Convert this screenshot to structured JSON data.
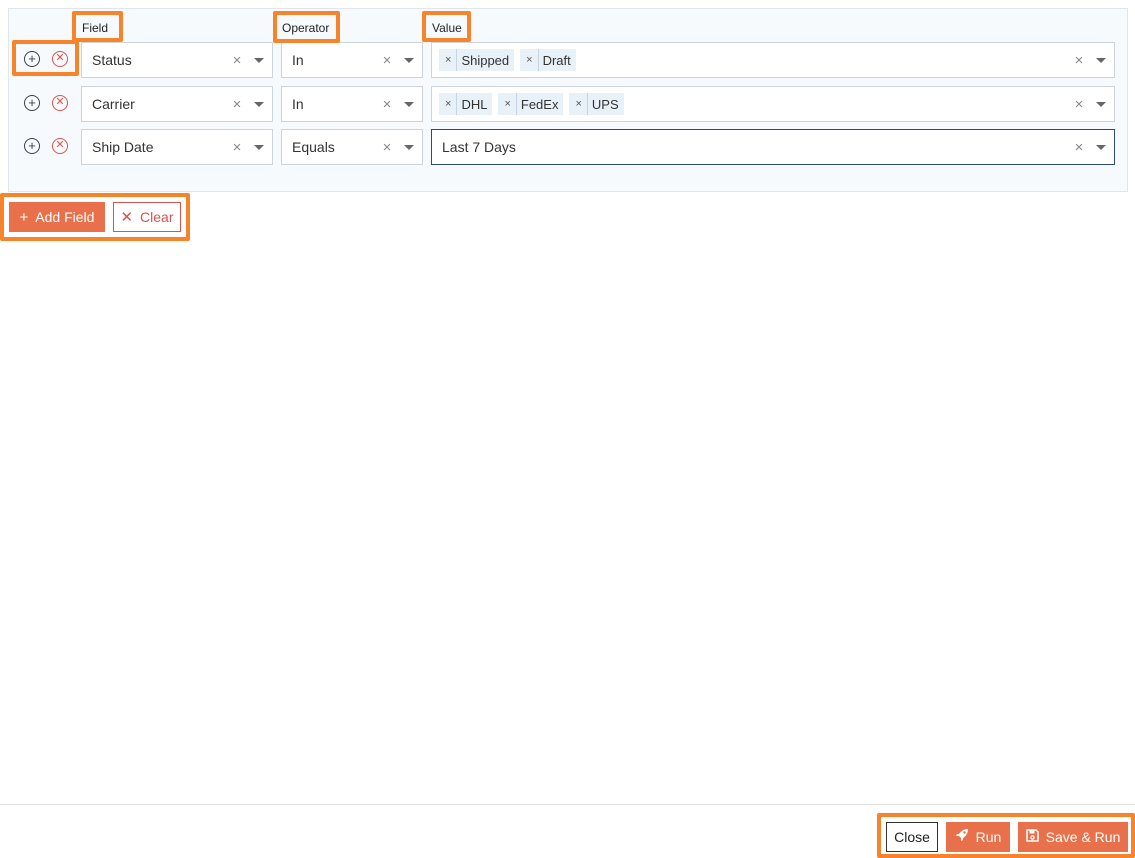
{
  "headers": {
    "field": "Field",
    "operator": "Operator",
    "value": "Value"
  },
  "rows": [
    {
      "field": "Status",
      "operator": "In",
      "value_tags": [
        "Shipped",
        "Draft"
      ]
    },
    {
      "field": "Carrier",
      "operator": "In",
      "value_tags": [
        "DHL",
        "FedEx",
        "UPS"
      ]
    },
    {
      "field": "Ship Date",
      "operator": "Equals",
      "value_text": "Last 7 Days"
    }
  ],
  "actions": {
    "add_field": "Add Field",
    "clear": "Clear"
  },
  "footer": {
    "close": "Close",
    "run": "Run",
    "save_and_run": "Save & Run"
  },
  "icons": {
    "add_row": "plus-circle-icon",
    "remove_row": "times-circle-icon",
    "clear_value": "x-icon",
    "dropdown": "caret-down-icon",
    "add_field": "plus-icon",
    "clear": "x-icon",
    "run": "rocket-icon",
    "save_and_run": "floppy-disk-icon"
  },
  "colors": {
    "accent": "#e8714b",
    "danger": "#d9534f",
    "highlight": "#f7842a",
    "panel_background": "#f7fafd"
  }
}
